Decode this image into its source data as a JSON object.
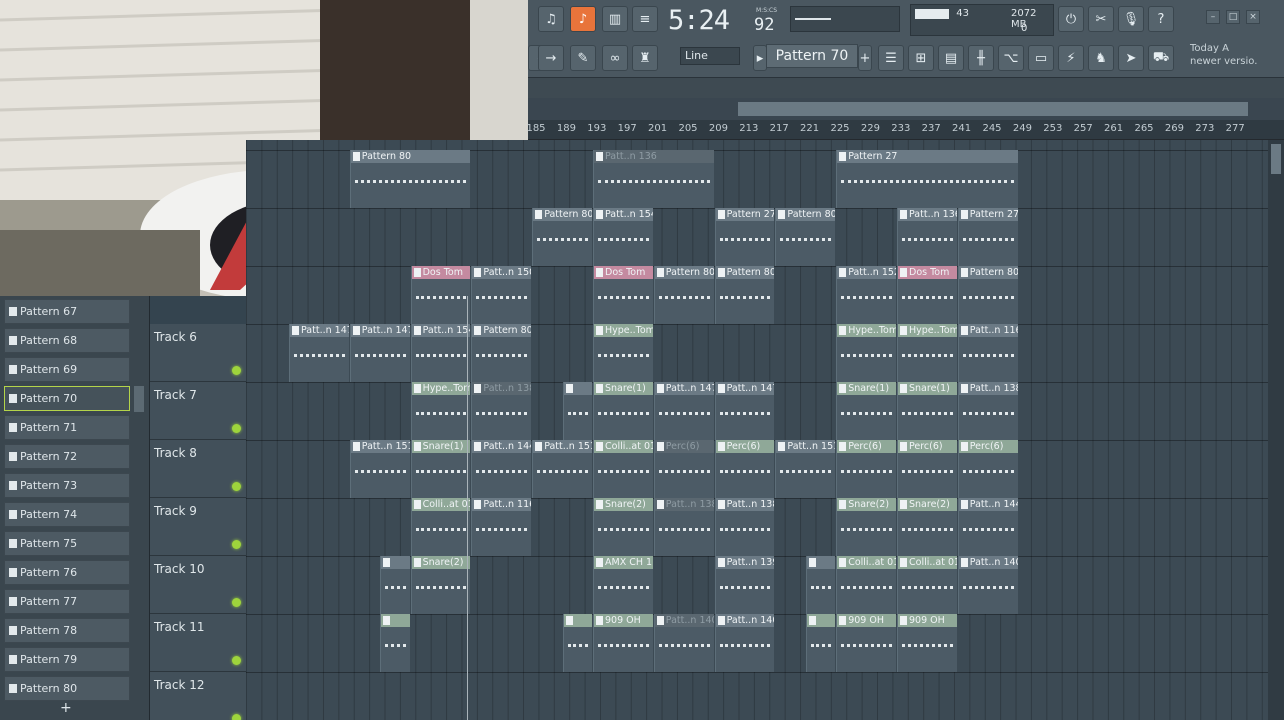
{
  "toolbar": {
    "time": "5:24",
    "time_frac": "92",
    "time_unit": "M:S:CS",
    "cpu": "43",
    "memory": "2072 MB",
    "polyphony": "0",
    "snap": "Line",
    "pattern": "Pattern 70",
    "news": "Today  A newer versio."
  },
  "ruler": [
    "185",
    "189",
    "193",
    "197",
    "201",
    "205",
    "209",
    "213",
    "217",
    "221",
    "225",
    "229",
    "233",
    "237",
    "241",
    "245",
    "249",
    "253",
    "257",
    "261",
    "265",
    "269",
    "273",
    "277"
  ],
  "picker": {
    "items": [
      "Pattern 67",
      "Pattern 68",
      "Pattern 69",
      "Pattern 70",
      "Pattern 71",
      "Pattern 72",
      "Pattern 73",
      "Pattern 74",
      "Pattern 75",
      "Pattern 76",
      "Pattern 77",
      "Pattern 78",
      "Pattern 79",
      "Pattern 80"
    ],
    "selected_index": 3,
    "add": "+"
  },
  "tracks": [
    "Track 6",
    "Track 7",
    "Track 8",
    "Track 9",
    "Track 10",
    "Track 11",
    "Track 12"
  ],
  "clips": [
    {
      "row": 0,
      "bar": 193,
      "len": 16,
      "label": "Pattern 80",
      "style": "normal"
    },
    {
      "row": 0,
      "bar": 225,
      "len": 16,
      "label": "Patt..n 136",
      "style": "muted"
    },
    {
      "row": 0,
      "bar": 257,
      "len": 24,
      "label": "Pattern 27",
      "style": "normal"
    },
    {
      "row": 1,
      "bar": 217,
      "len": 8,
      "label": "Pattern 80",
      "style": "normal"
    },
    {
      "row": 1,
      "bar": 225,
      "len": 8,
      "label": "Patt..n 154",
      "style": "normal"
    },
    {
      "row": 1,
      "bar": 241,
      "len": 8,
      "label": "Pattern 27",
      "style": "normal"
    },
    {
      "row": 1,
      "bar": 249,
      "len": 8,
      "label": "Pattern 80",
      "style": "normal"
    },
    {
      "row": 1,
      "bar": 265,
      "len": 8,
      "label": "Patt..n 136",
      "style": "normal"
    },
    {
      "row": 1,
      "bar": 273,
      "len": 8,
      "label": "Pattern 27",
      "style": "normal"
    },
    {
      "row": 2,
      "bar": 201,
      "len": 8,
      "label": "Dos Tom",
      "style": "pink"
    },
    {
      "row": 2,
      "bar": 209,
      "len": 8,
      "label": "Patt..n 150",
      "style": "normal"
    },
    {
      "row": 2,
      "bar": 225,
      "len": 8,
      "label": "Dos Tom",
      "style": "pink"
    },
    {
      "row": 2,
      "bar": 233,
      "len": 8,
      "label": "Pattern 80",
      "style": "normal"
    },
    {
      "row": 2,
      "bar": 241,
      "len": 8,
      "label": "Pattern 80",
      "style": "normal"
    },
    {
      "row": 2,
      "bar": 257,
      "len": 8,
      "label": "Patt..n 152",
      "style": "normal"
    },
    {
      "row": 2,
      "bar": 265,
      "len": 8,
      "label": "Dos Tom",
      "style": "pink"
    },
    {
      "row": 2,
      "bar": 273,
      "len": 8,
      "label": "Pattern 80",
      "style": "normal"
    },
    {
      "row": 3,
      "bar": 185,
      "len": 8,
      "label": "Patt..n 147",
      "style": "normal"
    },
    {
      "row": 3,
      "bar": 193,
      "len": 8,
      "label": "Patt..n 147",
      "style": "normal"
    },
    {
      "row": 3,
      "bar": 201,
      "len": 8,
      "label": "Patt..n 154",
      "style": "normal"
    },
    {
      "row": 3,
      "bar": 209,
      "len": 8,
      "label": "Pattern 80",
      "style": "normal"
    },
    {
      "row": 3,
      "bar": 225,
      "len": 8,
      "label": "Hype..Tom",
      "style": "green"
    },
    {
      "row": 3,
      "bar": 257,
      "len": 8,
      "label": "Hype..Tom",
      "style": "green"
    },
    {
      "row": 3,
      "bar": 265,
      "len": 8,
      "label": "Hype..Tom",
      "style": "green"
    },
    {
      "row": 3,
      "bar": 273,
      "len": 8,
      "label": "Patt..n 116",
      "style": "normal"
    },
    {
      "row": 4,
      "bar": 201,
      "len": 8,
      "label": "Hype..Tom",
      "style": "green"
    },
    {
      "row": 4,
      "bar": 209,
      "len": 8,
      "label": "Patt..n 138",
      "style": "muted"
    },
    {
      "row": 4,
      "bar": 221,
      "len": 4,
      "label": "",
      "style": "normal"
    },
    {
      "row": 4,
      "bar": 225,
      "len": 8,
      "label": "Snare(1)",
      "style": "green"
    },
    {
      "row": 4,
      "bar": 233,
      "len": 8,
      "label": "Patt..n 147",
      "style": "normal"
    },
    {
      "row": 4,
      "bar": 241,
      "len": 8,
      "label": "Patt..n 147",
      "style": "normal"
    },
    {
      "row": 4,
      "bar": 257,
      "len": 8,
      "label": "Snare(1)",
      "style": "green"
    },
    {
      "row": 4,
      "bar": 265,
      "len": 8,
      "label": "Snare(1)",
      "style": "green"
    },
    {
      "row": 4,
      "bar": 273,
      "len": 8,
      "label": "Patt..n 138",
      "style": "normal"
    },
    {
      "row": 5,
      "bar": 193,
      "len": 8,
      "label": "Patt..n 151",
      "style": "normal"
    },
    {
      "row": 5,
      "bar": 201,
      "len": 8,
      "label": "Snare(1)",
      "style": "green"
    },
    {
      "row": 5,
      "bar": 209,
      "len": 8,
      "label": "Patt..n 144",
      "style": "normal"
    },
    {
      "row": 5,
      "bar": 217,
      "len": 8,
      "label": "Patt..n 151",
      "style": "normal"
    },
    {
      "row": 5,
      "bar": 225,
      "len": 8,
      "label": "Colli..at 01",
      "style": "green"
    },
    {
      "row": 5,
      "bar": 233,
      "len": 8,
      "label": "Perc(6)",
      "style": "muted"
    },
    {
      "row": 5,
      "bar": 241,
      "len": 8,
      "label": "Perc(6)",
      "style": "green"
    },
    {
      "row": 5,
      "bar": 249,
      "len": 8,
      "label": "Patt..n 151",
      "style": "normal"
    },
    {
      "row": 5,
      "bar": 257,
      "len": 8,
      "label": "Perc(6)",
      "style": "green"
    },
    {
      "row": 5,
      "bar": 265,
      "len": 8,
      "label": "Perc(6)",
      "style": "green"
    },
    {
      "row": 5,
      "bar": 273,
      "len": 8,
      "label": "Perc(6)",
      "style": "green"
    },
    {
      "row": 6,
      "bar": 201,
      "len": 8,
      "label": "Colli..at 01",
      "style": "green"
    },
    {
      "row": 6,
      "bar": 209,
      "len": 8,
      "label": "Patt..n 116",
      "style": "normal"
    },
    {
      "row": 6,
      "bar": 225,
      "len": 8,
      "label": "Snare(2)",
      "style": "green"
    },
    {
      "row": 6,
      "bar": 233,
      "len": 8,
      "label": "Patt..n 138",
      "style": "muted"
    },
    {
      "row": 6,
      "bar": 241,
      "len": 8,
      "label": "Patt..n 138",
      "style": "normal"
    },
    {
      "row": 6,
      "bar": 257,
      "len": 8,
      "label": "Snare(2)",
      "style": "green"
    },
    {
      "row": 6,
      "bar": 265,
      "len": 8,
      "label": "Snare(2)",
      "style": "green"
    },
    {
      "row": 6,
      "bar": 273,
      "len": 8,
      "label": "Patt..n 144",
      "style": "normal"
    },
    {
      "row": 7,
      "bar": 197,
      "len": 4,
      "label": "",
      "style": "normal"
    },
    {
      "row": 7,
      "bar": 201,
      "len": 8,
      "label": "Snare(2)",
      "style": "green"
    },
    {
      "row": 7,
      "bar": 225,
      "len": 8,
      "label": "AMX CH 1",
      "style": "green"
    },
    {
      "row": 7,
      "bar": 241,
      "len": 8,
      "label": "Patt..n 139",
      "style": "normal"
    },
    {
      "row": 7,
      "bar": 253,
      "len": 4,
      "label": "",
      "style": "normal"
    },
    {
      "row": 7,
      "bar": 257,
      "len": 8,
      "label": "Colli..at 01",
      "style": "green"
    },
    {
      "row": 7,
      "bar": 265,
      "len": 8,
      "label": "Colli..at 01",
      "style": "green"
    },
    {
      "row": 7,
      "bar": 273,
      "len": 8,
      "label": "Patt..n 140",
      "style": "normal"
    },
    {
      "row": 8,
      "bar": 197,
      "len": 4,
      "label": "",
      "style": "green"
    },
    {
      "row": 8,
      "bar": 221,
      "len": 4,
      "label": "",
      "style": "green"
    },
    {
      "row": 8,
      "bar": 225,
      "len": 8,
      "label": "909 OH",
      "style": "green"
    },
    {
      "row": 8,
      "bar": 233,
      "len": 8,
      "label": "Patt..n 140",
      "style": "muted"
    },
    {
      "row": 8,
      "bar": 241,
      "len": 8,
      "label": "Patt..n 140",
      "style": "normal"
    },
    {
      "row": 8,
      "bar": 253,
      "len": 4,
      "label": "",
      "style": "green"
    },
    {
      "row": 8,
      "bar": 257,
      "len": 8,
      "label": "909 OH",
      "style": "green"
    },
    {
      "row": 8,
      "bar": 265,
      "len": 8,
      "label": "909 OH",
      "style": "green"
    }
  ]
}
